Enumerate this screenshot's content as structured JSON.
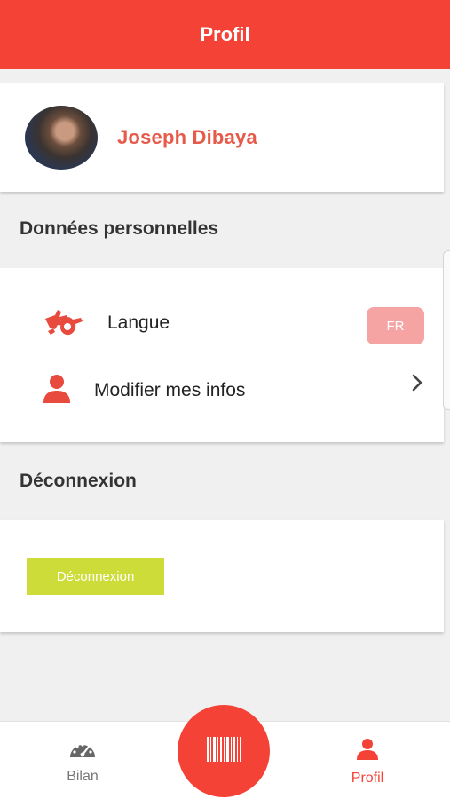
{
  "header": {
    "title": "Profil"
  },
  "profile": {
    "name": "Joseph Dibaya"
  },
  "sections": {
    "personal": {
      "title": "Données personnelles"
    },
    "logout": {
      "title": "Déconnexion"
    }
  },
  "settings": {
    "language": {
      "label": "Langue",
      "value": "FR",
      "icon": "sign-language-icon"
    },
    "edit_info": {
      "label": "Modifier mes infos",
      "icon": "user-icon"
    }
  },
  "logout": {
    "button_label": "Déconnexion"
  },
  "nav": {
    "items": [
      {
        "label": "Bilan",
        "icon": "dashboard-gauge-icon",
        "active": false
      },
      {
        "label": "Profil",
        "icon": "user-icon",
        "active": true
      }
    ],
    "fab_icon": "barcode-icon"
  },
  "colors": {
    "primary": "#f44336",
    "accent": "#cddc39",
    "badge": "#f6a3a3",
    "name": "#e65a4a"
  }
}
